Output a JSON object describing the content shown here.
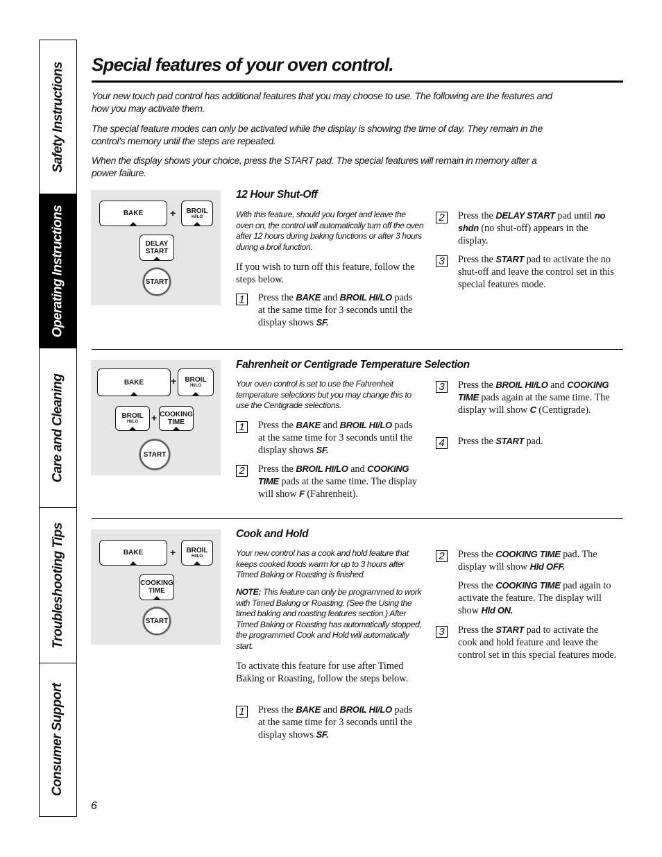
{
  "sidebar": {
    "tabs": [
      {
        "label": "Safety Instructions",
        "active": false
      },
      {
        "label": "Operating Instructions",
        "active": true
      },
      {
        "label": "Care and Cleaning",
        "active": false
      },
      {
        "label": "Troubleshooting Tips",
        "active": false
      },
      {
        "label": "Consumer Support",
        "active": false
      }
    ]
  },
  "page": {
    "title": "Special features of your oven control.",
    "intro": [
      "Your new touch pad control has additional features that you may choose to use. The following are the features and how you may activate them.",
      "The special feature modes can only be activated while the display is showing the time of day. They remain in the control’s memory until the steps are repeated.",
      "When the display shows your choice, press the START pad. The special features will remain in memory after a power failure."
    ],
    "page_number": "6"
  },
  "sections": [
    {
      "heading": "12 Hour Shut-Off",
      "pads": {
        "bake": "BAKE",
        "broil": "BROIL",
        "broil_sub": "HI/LO",
        "plus": "+",
        "delay_1": "DELAY",
        "delay_2": "START",
        "start": "START"
      },
      "description": "With this feature, should you forget and leave the oven on, the control will automatically turn off the oven after 12 hours during baking functions or after 3 hours during a broil function.",
      "lead": "If you wish to turn off this feature, follow the steps below.",
      "steps": [
        {
          "num": "1",
          "parts": [
            "Press the ",
            "BAKE",
            " and ",
            "BROIL HI/LO",
            " pads at the same time for 3 seconds until the display shows ",
            "SF."
          ]
        },
        {
          "num": "2",
          "parts": [
            "Press the ",
            "DELAY START",
            " pad until ",
            "no shdn",
            " (no shut-off) appears in the display."
          ]
        },
        {
          "num": "3",
          "parts": [
            "Press the ",
            "START",
            " pad to activate the no shut-off and leave the control set in this special features mode."
          ]
        }
      ]
    },
    {
      "heading": "Fahrenheit or Centigrade Temperature Selection",
      "pads": {
        "bake": "BAKE",
        "broil": "BROIL",
        "broil_sub": "HI/LO",
        "plus": "+",
        "cook_1": "COOKING",
        "cook_2": "TIME",
        "start": "START"
      },
      "description": "Your oven control is set to use the Fahrenheit temperature selections but you may change this to use the Centigrade selections.",
      "steps": [
        {
          "num": "1",
          "parts": [
            "Press the ",
            "BAKE",
            " and ",
            "BROIL HI/LO",
            " pads at the same time for 3 seconds until the display shows ",
            "SF."
          ]
        },
        {
          "num": "2",
          "parts": [
            "Press the ",
            "BROIL HI/LO",
            " and ",
            "COOKING TIME",
            " pads at the same time. The display will show ",
            "F",
            " (Fahrenheit)."
          ]
        },
        {
          "num": "3",
          "parts": [
            "Press the ",
            "BROIL HI/LO",
            " and ",
            "COOKING TIME",
            " pads again at the same time. The display will show ",
            "C",
            " (Centigrade)."
          ]
        },
        {
          "num": "4",
          "parts": [
            "Press the ",
            "START",
            " pad."
          ]
        }
      ]
    },
    {
      "heading": "Cook and Hold",
      "pads": {
        "bake": "BAKE",
        "broil": "BROIL",
        "broil_sub": "HI/LO",
        "plus": "+",
        "cook_1": "COOKING",
        "cook_2": "TIME",
        "start": "START"
      },
      "description": "Your new control has a cook and hold feature that keeps cooked foods warm for up to 3 hours after Timed Baking or Roasting is finished.",
      "note_label": "NOTE:",
      "note": " This feature can only be programmed to work with Timed Baking or Roasting. (See the Using the timed baking and roasting features section.) After Timed Baking or Roasting has automatically stopped, the programmed Cook and Hold will automatically start.",
      "lead": "To activate this feature for use after Timed Baking or Roasting, follow the steps below.",
      "steps": [
        {
          "num": "1",
          "parts": [
            "Press the ",
            "BAKE",
            " and ",
            "BROIL HI/LO",
            " pads at the same time for 3 seconds until the display shows ",
            "SF."
          ]
        },
        {
          "num": "2",
          "parts": [
            "Press the ",
            "COOKING TIME",
            " pad. The display will show ",
            "Hld OFF."
          ]
        },
        {
          "num": "",
          "parts": [
            "Press the ",
            "COOKING TIME",
            " pad again to activate the feature. The display will show ",
            "Hld ON."
          ]
        },
        {
          "num": "3",
          "parts": [
            "Press the ",
            "START",
            " pad to activate the cook and hold feature and leave the control set in this special features mode."
          ]
        }
      ]
    }
  ]
}
